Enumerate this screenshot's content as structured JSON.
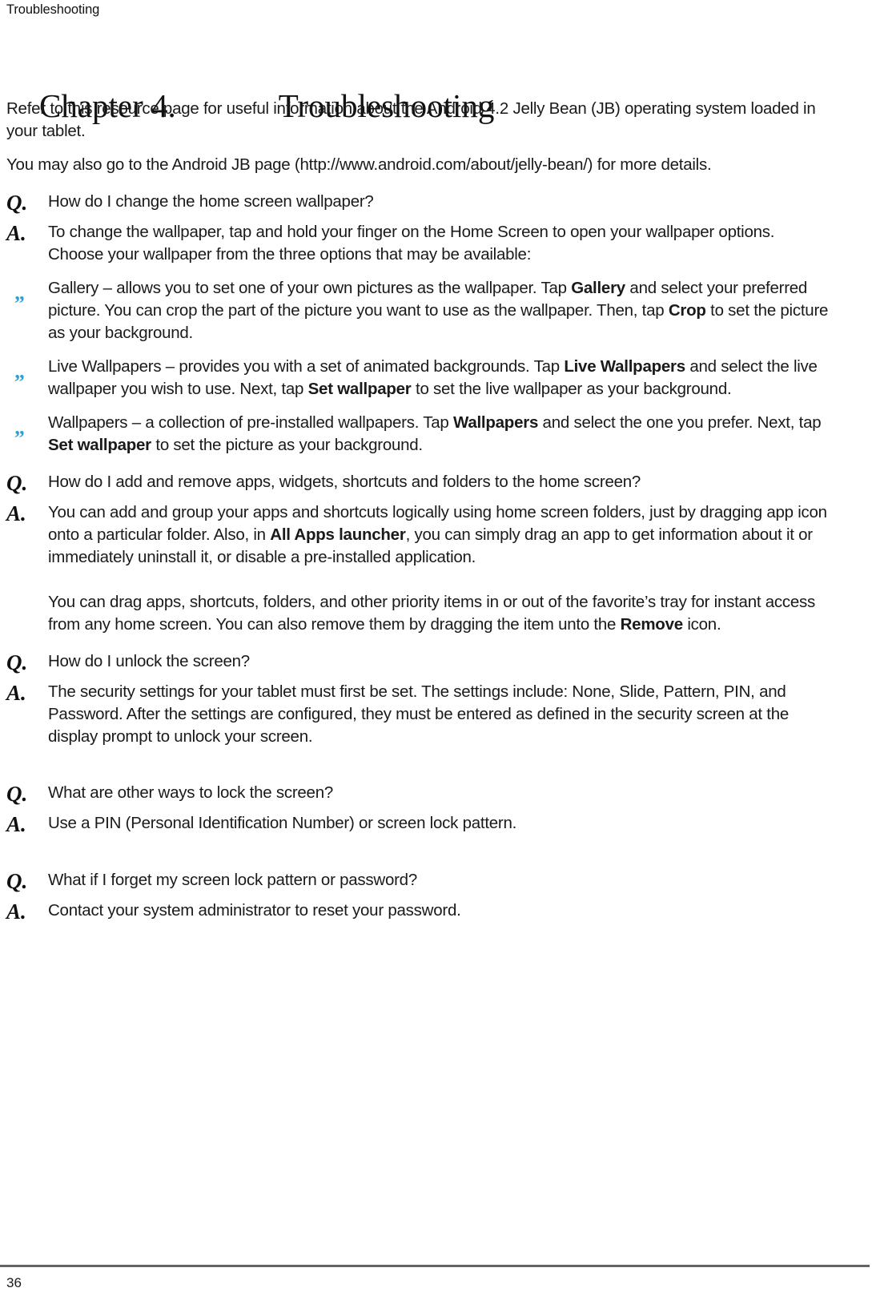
{
  "header": {
    "running_title": "Troubleshooting"
  },
  "chapter": {
    "label": "Chapter 4.",
    "title": "Troubleshooting"
  },
  "intro": {
    "paragraph1": "Refer to this resource page for useful information about the Android 4.2 Jelly Bean (JB) operating system loaded in your tablet.",
    "paragraph2": "You may also go to the Android JB page (http://www.android.com/about/jelly-bean/) for more details."
  },
  "markers": {
    "question": "Q.",
    "answer": "A.",
    "bullet": "„"
  },
  "colors": {
    "bullet_blue": "#2f9fd8",
    "rule_gray": "#636467",
    "text": "#1a1a1a"
  },
  "qa": [
    {
      "question": "How do I change the home screen wallpaper?",
      "answer_intro": "To change the wallpaper, tap and hold your finger on the Home Screen to open your wallpaper options. Choose your wallpaper from the three options that may be available:",
      "bullets": [
        {
          "part1": "Gallery – allows you to set one of your own pictures as the wallpaper. Tap ",
          "bold1": "Gallery",
          "part2": " and select your preferred picture. You can crop the part of the picture you want to use as the wallpaper. Then, tap ",
          "bold2": "Crop",
          "part3": " to set the picture as your background."
        },
        {
          "part1": "Live Wallpapers – provides you with a set of animated backgrounds. Tap ",
          "bold1": "Live Wallpapers",
          "part2": " and select the live wallpaper you wish to use. Next, tap ",
          "bold2": "Set wallpaper",
          "part3": " to set the live wallpaper as your background."
        },
        {
          "part1": "Wallpapers – a collection of pre-installed wallpapers. Tap ",
          "bold1": "Wallpapers",
          "part2": " and select the one you prefer. Next, tap ",
          "bold2": "Set wallpaper",
          "part3": " to set the picture as your background."
        }
      ]
    },
    {
      "question": "How do I add and remove apps, widgets, shortcuts and folders to the home screen?",
      "answer_p1_part1": "You can add and group your apps and shortcuts logically using home screen folders, just by dragging app icon onto a particular folder. Also, in ",
      "answer_p1_bold": "All Apps launcher",
      "answer_p1_part2": ", you can simply drag an app to get information about it or immediately uninstall it, or disable a pre-installed application.",
      "answer_p2_part1": "You can drag apps, shortcuts, folders, and other priority items in or out of the favorite’s tray for instant access from any home screen. You can also remove them by dragging the item unto the ",
      "answer_p2_bold": "Remove",
      "answer_p2_part2": " icon."
    },
    {
      "question": "How do I unlock the screen?",
      "answer": "The security settings for your tablet must first be set. The settings include: None, Slide, Pattern, PIN, and Password. After the settings are configured, they must be entered as defined in the security screen at the display prompt to unlock your screen."
    },
    {
      "question": "What are other ways to lock the screen?",
      "answer": "Use a PIN (Personal Identification Number) or screen lock pattern."
    },
    {
      "question": "What if I forget my screen lock pattern or password?",
      "answer": "Contact your system administrator to reset your password."
    }
  ],
  "footer": {
    "page_number": "36"
  }
}
